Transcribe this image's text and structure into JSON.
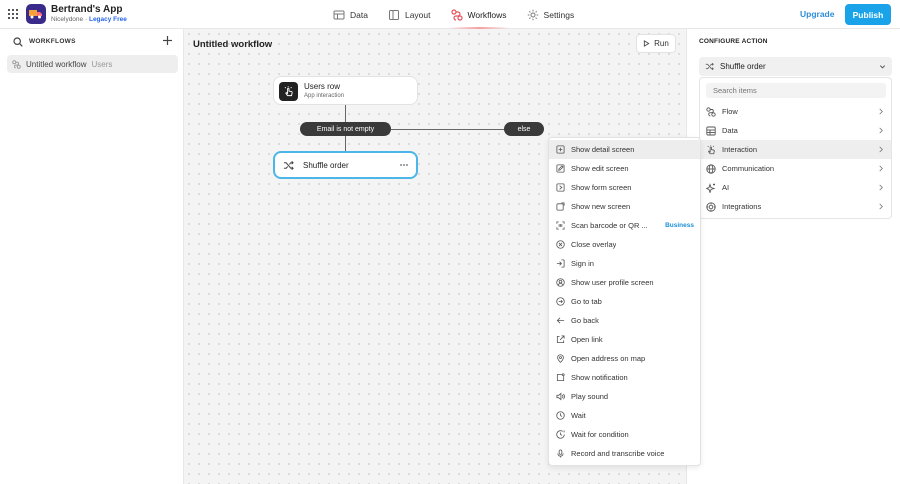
{
  "app": {
    "name": "Bertrand's App",
    "org": "Nicelydone",
    "separator": "·",
    "plan": "Legacy Free"
  },
  "nav": {
    "data": "Data",
    "layout": "Layout",
    "workflows": "Workflows",
    "settings": "Settings"
  },
  "header": {
    "upgrade": "Upgrade",
    "publish": "Publish"
  },
  "sidebar": {
    "title": "WORKFLOWS",
    "workflow_name": "Untitled workflow",
    "workflow_table": "Users"
  },
  "canvas": {
    "title": "Untitled workflow",
    "run": "Run",
    "trigger_title": "Users row",
    "trigger_subtitle": "App interaction",
    "condition": "Email is not empty",
    "else": "else",
    "action": "Shuffle order"
  },
  "menu": {
    "items": [
      "Show detail screen",
      "Show edit screen",
      "Show form screen",
      "Show new screen",
      "Scan barcode or QR ...",
      "Close overlay",
      "Sign in",
      "Show user profile screen",
      "Go to tab",
      "Go back",
      "Open link",
      "Open address on map",
      "Show notification",
      "Play sound",
      "Wait",
      "Wait for condition",
      "Record and transcribe voice"
    ],
    "business_badge": "Business"
  },
  "config": {
    "title": "CONFIGURE ACTION",
    "selected": "Shuffle order",
    "search_placeholder": "Search items",
    "categories": [
      "Flow",
      "Data",
      "Interaction",
      "Communication",
      "AI",
      "Integrations"
    ]
  },
  "colors": {
    "accent": "#1aa3e8",
    "upgrade": "#2f8ed8",
    "workflows_icon": "#e8505b",
    "selected_node_border": "#4cb6e8",
    "logo_bg": "#3a2b8a",
    "badge": "#1c8fd6"
  }
}
